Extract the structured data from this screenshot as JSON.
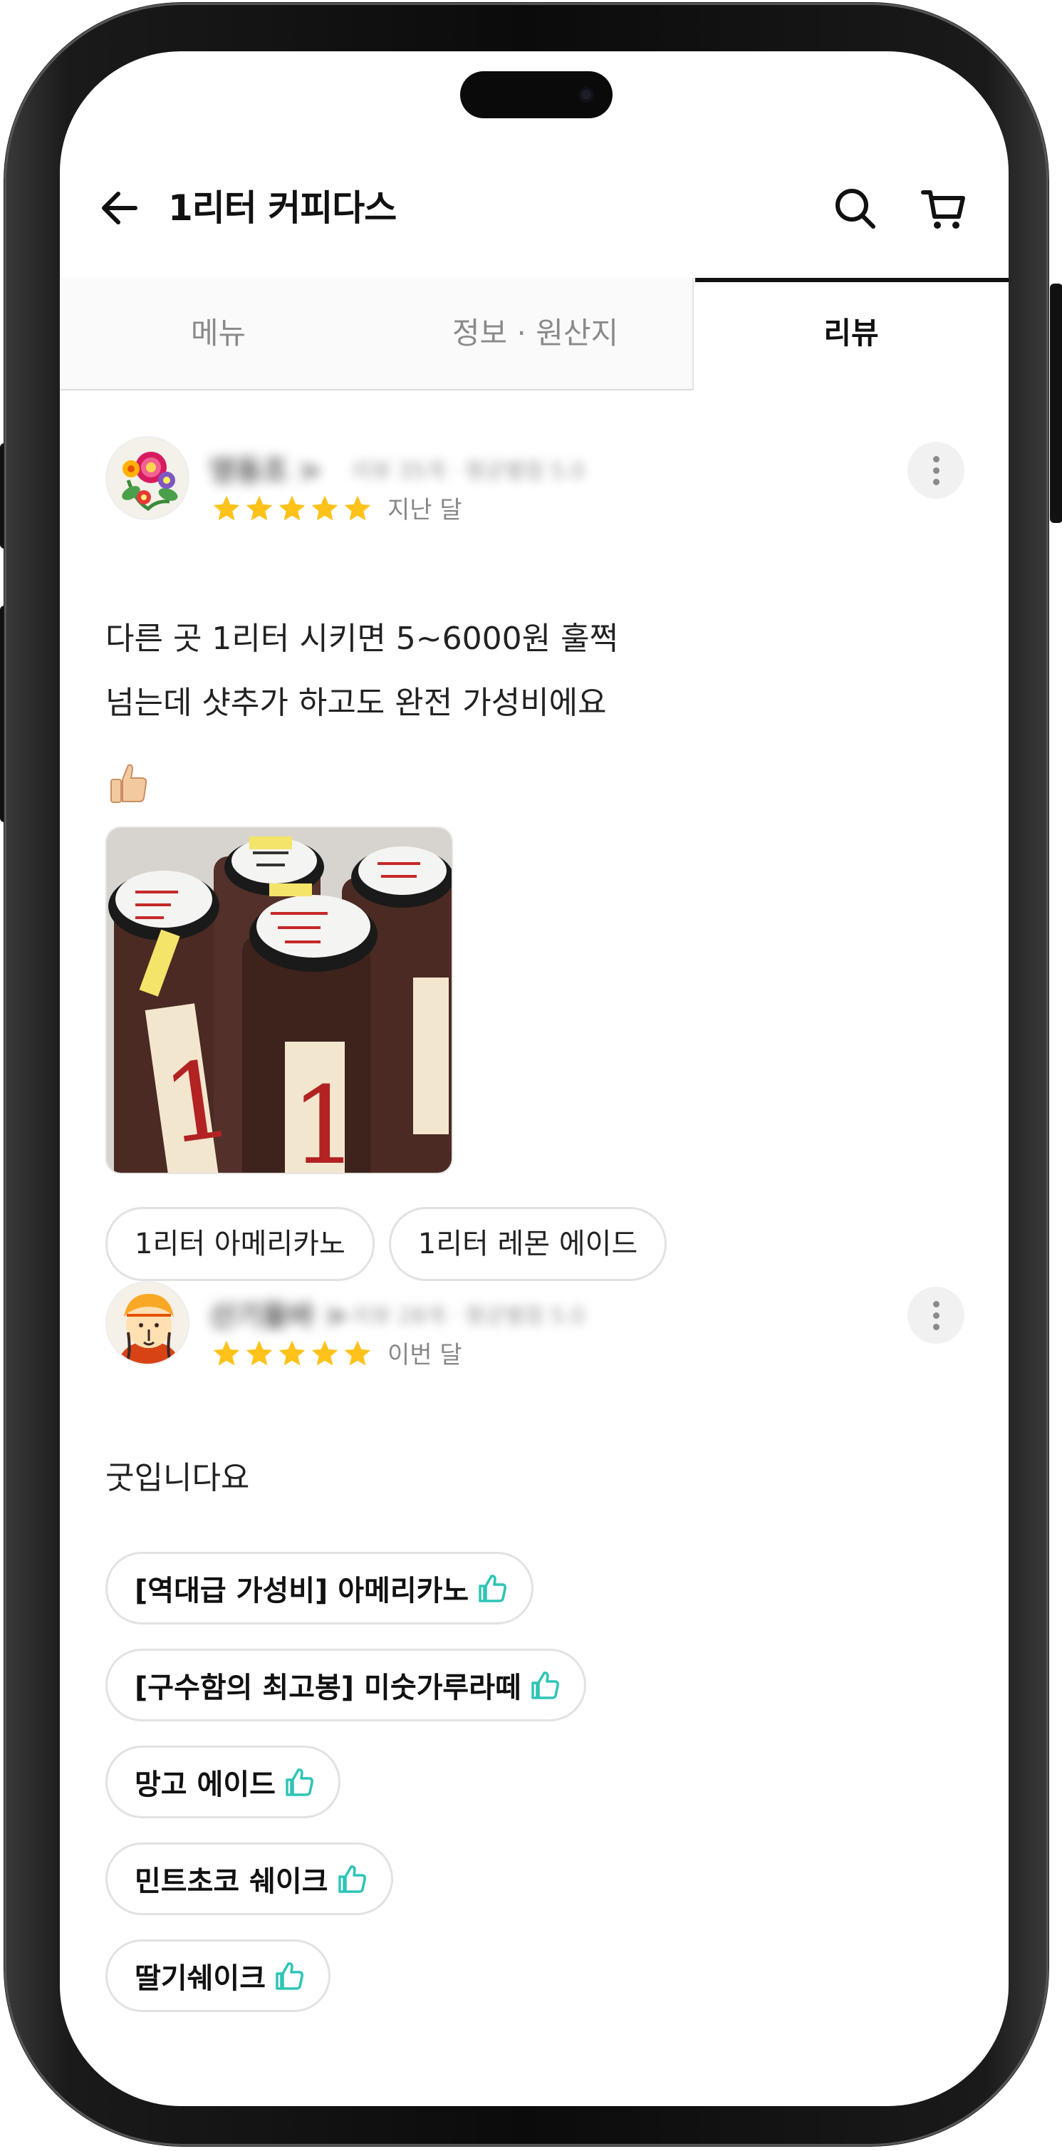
{
  "header": {
    "title": "1리터 커피다스"
  },
  "tabs": [
    {
      "label": "메뉴",
      "active": false
    },
    {
      "label": "정보 · 원산지",
      "active": false
    },
    {
      "label": "리뷰",
      "active": true
    }
  ],
  "reviews": [
    {
      "author_blurred": "영동조 >",
      "meta_blurred": "리뷰 35개 · 평균별점 5.0",
      "rating": 5,
      "date": "지난 달",
      "text": "다른 곳 1리터 시키면 5~6000원 훌쩍\n 넘는데 샷추가 하고도 완전 가성비에요",
      "ordered_items": [
        "1리터 아메리카노",
        "1리터 레몬 에이드"
      ]
    },
    {
      "author_blurred": "산기들바 >",
      "meta_blurred": "리뷰 28개 · 평균별점 5.0",
      "rating": 5,
      "date": "이번 달",
      "text": "굿입니다요",
      "recommended_items": [
        "[역대급 가성비] 아메리카노",
        "[구수함의 최고봉] 미숫가루라떼",
        "망고 에이드",
        "민트초코 쉐이크",
        "딸기쉐이크"
      ]
    }
  ],
  "colors": {
    "star": "#FFC21A",
    "thumb_icon": "#2EC4B6",
    "text": "#111111",
    "muted": "#888888"
  },
  "icons": {
    "back": "arrow-left-icon",
    "search": "search-icon",
    "cart": "cart-icon",
    "more": "more-vertical-icon",
    "thumb": "thumbs-up-icon"
  }
}
